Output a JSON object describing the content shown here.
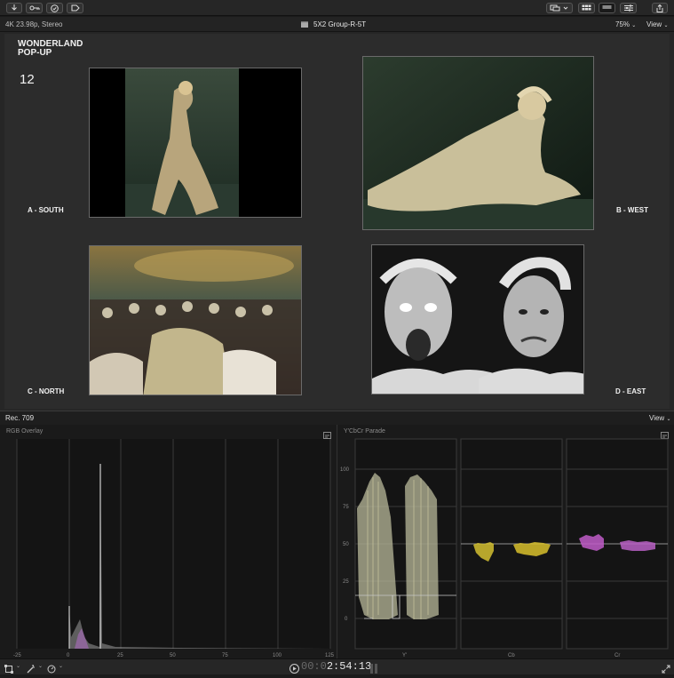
{
  "toolbar": {
    "left_buttons": [
      "download-icon",
      "key-icon",
      "checkmark-icon",
      "tag-icon"
    ],
    "right_buttons": [
      "clip-appearance-icon",
      "grid-layout-icon",
      "filmstrip-icon",
      "adjustments-icon",
      "share-icon"
    ]
  },
  "infobar": {
    "format": "4K 23.98p, Stereo",
    "clip_name": "5X2 Group-R-5T",
    "zoom": "75%",
    "view_menu": "View"
  },
  "viewer": {
    "title_line1": "WONDERLAND",
    "title_line2": "POP-UP",
    "number": "12",
    "quadrants": {
      "south": "A - SOUTH",
      "west": "B - WEST",
      "north": "C - NORTH",
      "east": "D - EAST"
    }
  },
  "scopes_bar": {
    "color_space": "Rec. 709",
    "view_menu": "View"
  },
  "rgb_overlay": {
    "title": "RGB Overlay",
    "x_ticks": [
      "-25",
      "0",
      "25",
      "50",
      "75",
      "100",
      "125"
    ]
  },
  "parade": {
    "title": "Y'CbCr Parade",
    "y_ticks": [
      "0",
      "25",
      "50",
      "75",
      "100"
    ],
    "channels": [
      "Y'",
      "Cb",
      "Cr"
    ]
  },
  "timeline": {
    "timecode_dim": "00:0",
    "timecode": "2:54:13"
  }
}
